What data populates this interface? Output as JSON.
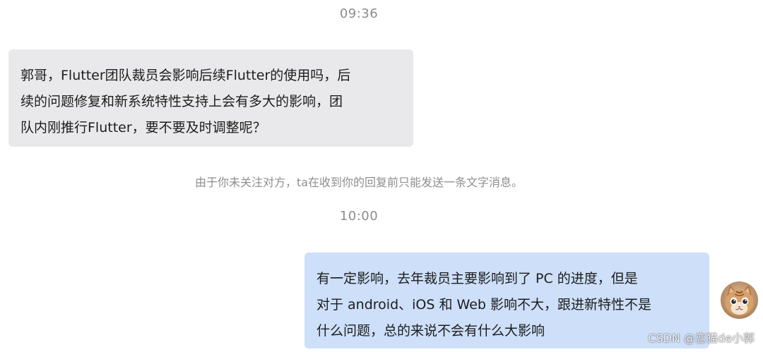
{
  "chat": {
    "timestamp_1": "09:36",
    "incoming_message": {
      "lines": [
        "郭哥，Flutter团队裁员会影响后续Flutter的使用吗，后",
        "续的问题修复和新系统特性支持上会有多大的影响，团",
        "队内刚推行Flutter，要不要及时调整呢？"
      ]
    },
    "system_notice": "由于你未关注对方，ta在收到你的回复前只能发送一条文字消息。",
    "timestamp_2": "10:00",
    "outgoing_message": {
      "lines": [
        "有一定影响，去年裁员主要影响到了 PC 的进度，但是",
        "对于 android、iOS 和 Web 影响不大，跟进新特性不是",
        "什么问题，总的来说不会有什么大影响"
      ]
    },
    "avatar_icon": "cat-avatar-icon"
  },
  "watermark": "CSDN @恋猫de小郭",
  "colors": {
    "background": "#ffffff",
    "incoming_bubble": "#e9e9eb",
    "outgoing_bubble": "#cddff9",
    "text": "#1c1c1c",
    "meta_text": "#8c8c8c"
  }
}
